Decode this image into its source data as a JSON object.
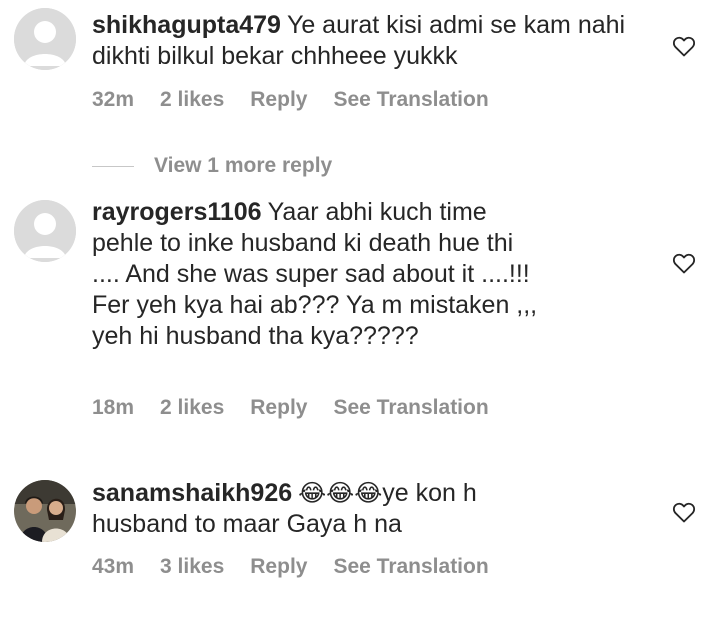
{
  "comments": [
    {
      "username": "shikhagupta479",
      "text": "Ye aurat kisi admi se kam nahi dikhti bilkul bekar chhheee yukkk",
      "time": "32m",
      "likes": "2 likes",
      "reply": "Reply",
      "translate": "See Translation"
    },
    {
      "username": "rayrogers1106",
      "text": "Yaar abhi kuch time pehle to inke husband ki death hue thi .... And she was super sad about it ....!!! Fer yeh kya hai ab??? Ya m mistaken ,,, yeh hi husband tha kya?????",
      "time": "18m",
      "likes": "2 likes",
      "reply": "Reply",
      "translate": "See Translation"
    },
    {
      "username": "sanamshaikh926",
      "emojis": "😂😂😂",
      "text": "ye kon h husband to maar Gaya h na",
      "time": "43m",
      "likes": "3 likes",
      "reply": "Reply",
      "translate": "See Translation"
    }
  ],
  "view_more_replies": "View 1 more reply",
  "colors": {
    "text": "#262626",
    "meta": "#8e8e8e",
    "avatar_placeholder": "#dbdbdb"
  }
}
